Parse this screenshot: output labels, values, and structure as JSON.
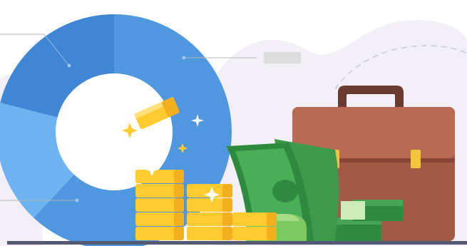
{
  "illustration": {
    "subject": "finance-illustration",
    "elements": [
      "donut-chart",
      "gold-coin-stacks",
      "banknote-stacks",
      "briefcase",
      "sparkle-icons"
    ]
  },
  "chart_data": {
    "type": "pie",
    "style": "donut",
    "labels": [],
    "values": [
      62,
      17,
      21
    ],
    "colors": [
      "#4F97DE",
      "#6DB3F2",
      "#3F86D4"
    ],
    "legend": "none"
  },
  "colors": {
    "background_blob": "#F2EFF7",
    "donut_dark": "#3F86D4",
    "donut_mid": "#4F97DE",
    "donut_light": "#6DB3F2",
    "coin": "#FFCB2E",
    "coin_shade": "#F2B01E",
    "bill_green": "#2E8A3D",
    "bill_light": "#7CC95F",
    "briefcase": "#A35A45",
    "briefcase_top": "#B86B52",
    "clasp": "#F3C43E",
    "leader_line": "#B7B7B7",
    "label_box": "#DCDCDC",
    "floor": "#545A73"
  }
}
